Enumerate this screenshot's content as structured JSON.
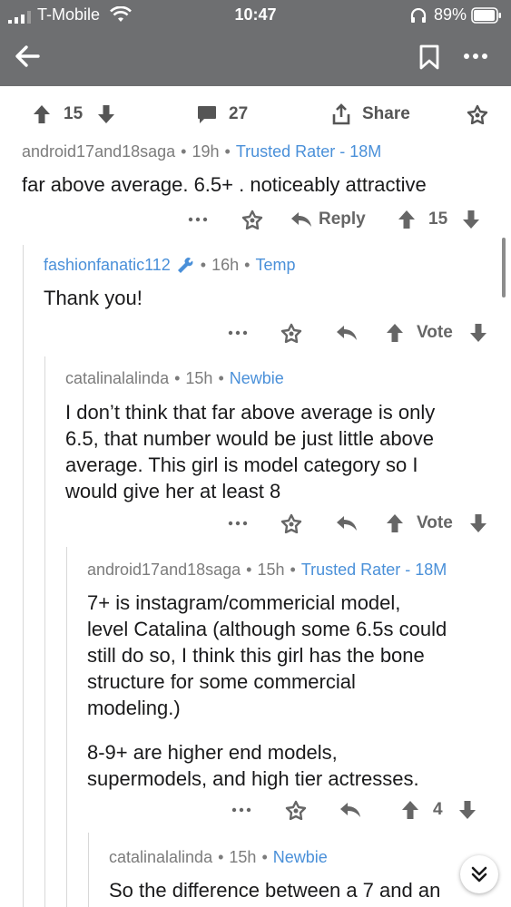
{
  "status_bar": {
    "carrier": "T-Mobile",
    "time": "10:47",
    "battery": "89%"
  },
  "nav": {
    "back": "back-arrow",
    "bookmark": "bookmark",
    "more": "more"
  },
  "post_actions": {
    "upvotes": "15",
    "comments": "27",
    "share_label": "Share"
  },
  "comments": [
    {
      "user": "android17and18saga",
      "age": "19h",
      "flair": "Trusted Rater - 18M",
      "body": "far above average. 6.5+ . noticeably attractive",
      "reply_label": "Reply",
      "score": "15"
    },
    {
      "user": "fashionfanatic112",
      "age": "16h",
      "flair": "Temp",
      "body": "Thank you!",
      "score": "Vote"
    },
    {
      "user": "catalinalalinda",
      "age": "15h",
      "flair": "Newbie",
      "body_lines": [
        "I don’t think that far above average is only",
        "6.5, that number would be just little above",
        "average. This girl is model category so I",
        "would give her at least 8"
      ],
      "score": "Vote"
    },
    {
      "user": "android17and18saga",
      "age": "15h",
      "flair": "Trusted Rater - 18M",
      "body_lines": [
        "7+ is  instagram/commericial model,",
        "level Catalina (although some 6.5s could",
        "still do so, I think this girl has the bone",
        "structure for some commercial",
        "modeling.)"
      ],
      "body_lines_2": [
        "8-9+ are higher end models,",
        "supermodels, and high tier actresses."
      ],
      "score": "4"
    },
    {
      "user": "catalinalalinda",
      "age": "15h",
      "flair": "Newbie",
      "body": "So the difference between a 7 and an"
    }
  ],
  "colors": {
    "header": "#6e6f71",
    "flair": "#4a90d9",
    "meta": "#7c7c7c"
  }
}
